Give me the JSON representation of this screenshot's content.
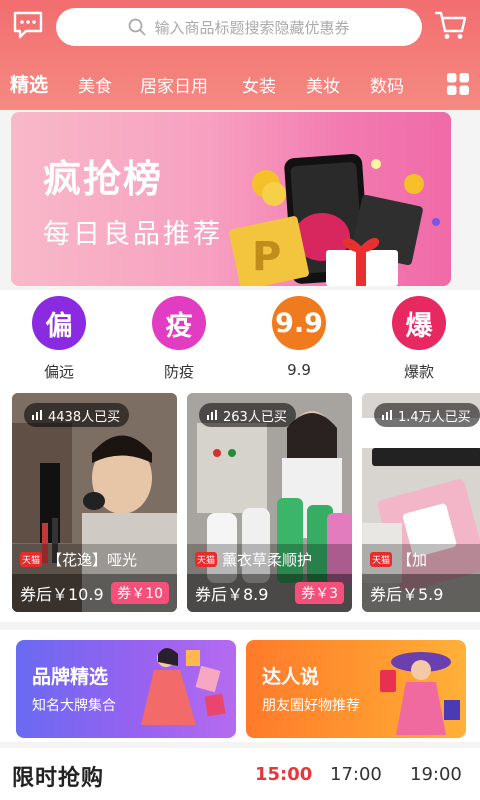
{
  "header": {
    "search_placeholder": "输入商品标题搜索隐藏优惠券",
    "tabs": [
      {
        "label": "精选"
      },
      {
        "label": "美食"
      },
      {
        "label": "居家日用"
      },
      {
        "label": "女装"
      },
      {
        "label": "美妆"
      },
      {
        "label": "数码"
      }
    ],
    "icons": [
      "message-icon",
      "search-icon",
      "cart-icon",
      "grid-icon"
    ]
  },
  "banner": {
    "title": "疯抢榜",
    "subtitle": "每日良品推荐"
  },
  "categories": [
    {
      "glyph": "偏",
      "label": "偏远",
      "color": "#8a2be2"
    },
    {
      "glyph": "疫",
      "label": "防疫",
      "color": "#e23cc3"
    },
    {
      "glyph": "9.9",
      "label": "9.9",
      "color": "#f07a1e"
    },
    {
      "glyph": "爆",
      "label": "爆款",
      "color": "#e82860"
    }
  ],
  "products": [
    {
      "sold": "4438人已买",
      "name": "【花逸】哑光",
      "price": "券后￥10.9",
      "coupon": "券￥10",
      "badge": "天猫"
    },
    {
      "sold": "263人已买",
      "name": "薰衣草柔顺护",
      "price": "券后￥8.9",
      "coupon": "券￥3",
      "badge": "天猫"
    },
    {
      "sold": "1.4万人已买",
      "name": "【加",
      "price": "券后￥5.9",
      "coupon": "",
      "badge": "天猫"
    }
  ],
  "promos": [
    {
      "title": "品牌精选",
      "subtitle": "知名大牌集合"
    },
    {
      "title": "达人说",
      "subtitle": "朋友圈好物推荐"
    }
  ],
  "flash_sale": {
    "title": "限时抢购",
    "times": [
      {
        "label": "15:00",
        "active": true
      },
      {
        "label": "17:00",
        "active": false
      },
      {
        "label": "19:00",
        "active": false
      }
    ]
  },
  "colors": {
    "header": "#f26d6f",
    "accent": "#e8373c",
    "coupon": "#f4507a"
  }
}
